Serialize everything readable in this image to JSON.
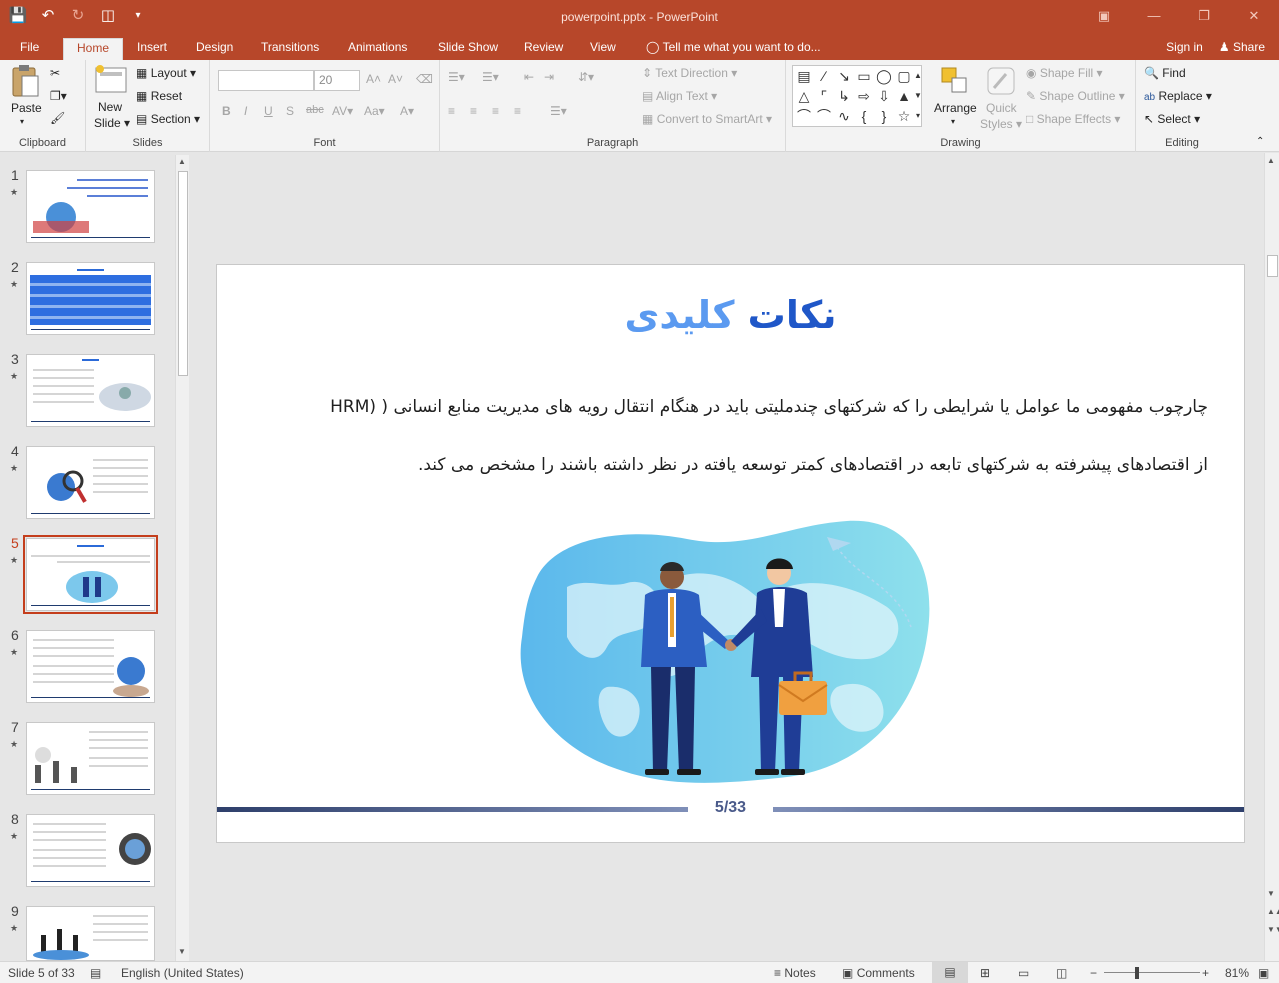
{
  "titlebar": {
    "title": "powerpoint.pptx - PowerPoint"
  },
  "tabs": {
    "items": [
      "File",
      "Home",
      "Insert",
      "Design",
      "Transitions",
      "Animations",
      "Slide Show",
      "Review",
      "View"
    ],
    "tell_me": "Tell me what you want to do...",
    "sign_in": "Sign in",
    "share": "Share"
  },
  "ribbon": {
    "clipboard": {
      "paste": "Paste",
      "label": "Clipboard"
    },
    "slides": {
      "new_slide_1": "New",
      "new_slide_2": "Slide",
      "layout": "Layout",
      "reset": "Reset",
      "section": "Section",
      "label": "Slides"
    },
    "font": {
      "font_name": "",
      "font_size": "20",
      "label": "Font"
    },
    "paragraph": {
      "text_direction": "Text Direction",
      "align_text": "Align Text",
      "convert_smartart": "Convert to SmartArt",
      "label": "Paragraph"
    },
    "drawing": {
      "arrange": "Arrange",
      "quick_styles_1": "Quick",
      "quick_styles_2": "Styles",
      "shape_fill": "Shape Fill",
      "shape_outline": "Shape Outline",
      "shape_effects": "Shape Effects",
      "label": "Drawing"
    },
    "editing": {
      "find": "Find",
      "replace": "Replace",
      "select": "Select",
      "label": "Editing"
    }
  },
  "thumbnails": {
    "numbers": [
      "1",
      "2",
      "3",
      "4",
      "5",
      "6",
      "7",
      "8",
      "9"
    ],
    "active": "5"
  },
  "slide": {
    "title_word1": "نکات",
    "title_word2": "کلیدی",
    "line1": "چارچوب مفهومی ما عوامل یا شرایطی را که شرکتهای چندملیتی باید در هنگام انتقال رویه های مدیریت منابع انسانی ( (HRM",
    "line2": "از اقتصادهای پیشرفته به شرکتهای تابعه در اقتصادهای کمتر توسعه یافته در نظر داشته باشند را مشخص می کند.",
    "page_number": "5/33"
  },
  "status": {
    "slide_info": "Slide 5 of 33",
    "language": "English (United States)",
    "notes": "Notes",
    "comments": "Comments",
    "zoom": "81%"
  },
  "colors": {
    "accent": "#b7472a",
    "title_blue": "#1f57c8",
    "title_light_blue": "#5b9af0",
    "footer_navy": "#2e3f6b"
  }
}
